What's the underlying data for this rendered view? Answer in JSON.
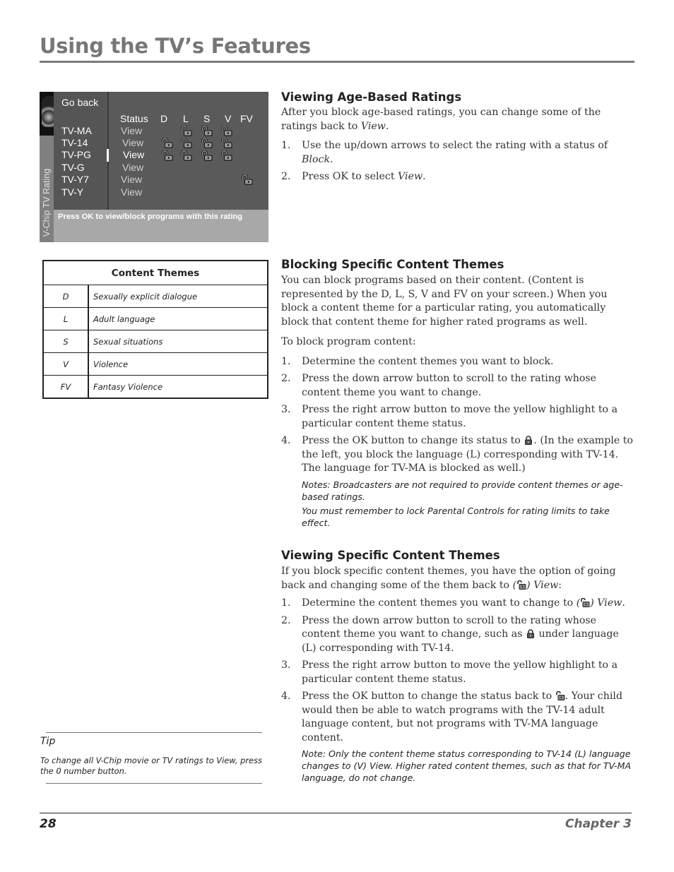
{
  "header": {
    "title": "Using the TV’s Features"
  },
  "tv_screen": {
    "side_label": "V-Chip TV Rating",
    "go_back": "Go back",
    "columns": [
      "Status",
      "D",
      "L",
      "S",
      "V",
      "FV"
    ],
    "ratings": [
      {
        "name": "TV-MA",
        "status": "View",
        "unlocked": [
          "L",
          "S",
          "V"
        ]
      },
      {
        "name": "TV-14",
        "status": "View",
        "unlocked": [
          "D",
          "L",
          "S",
          "V"
        ]
      },
      {
        "name": "TV-PG",
        "status": "View",
        "unlocked": [
          "D",
          "L",
          "S",
          "V"
        ]
      },
      {
        "name": "TV-G",
        "status": "View",
        "unlocked": []
      },
      {
        "name": "TV-Y7",
        "status": "View",
        "unlocked": [
          "FV"
        ]
      },
      {
        "name": "TV-Y",
        "status": "View",
        "unlocked": []
      }
    ],
    "selected_rating": "TV-PG",
    "footer": "Press OK to view/block programs with this rating",
    "icon": "unlocked-padlock-icon"
  },
  "content_themes_table": {
    "title": "Content Themes",
    "rows": [
      {
        "code": "D",
        "meaning": "Sexually explicit dialogue"
      },
      {
        "code": "L",
        "meaning": "Adult language"
      },
      {
        "code": "S",
        "meaning": "Sexual situations"
      },
      {
        "code": "V",
        "meaning": "Violence"
      },
      {
        "code": "FV",
        "meaning": "Fantasy Violence"
      }
    ]
  },
  "sections": {
    "age_based": {
      "heading": "Viewing Age-Based Ratings",
      "intro_a": "After you block age-based ratings, you can change some of the ratings back to ",
      "intro_em": "View",
      "intro_b": ".",
      "steps": [
        {
          "num": "1.",
          "a": "Use the up/down arrows to select the rating with a status of ",
          "em": "Block",
          "b": "."
        },
        {
          "num": "2.",
          "a": "Press OK to select ",
          "em": "View",
          "b": "."
        }
      ]
    },
    "blocking": {
      "heading": "Blocking Specific Content Themes",
      "intro": "You can block programs based on their content. (Content is represented by the D, L, S, V and FV on your screen.) When you block a content theme for a particular rating, you automatically block that content theme for higher rated programs as well.",
      "lead": "To block program content:",
      "steps": [
        {
          "num": "1.",
          "text": "Determine the content themes you want to block."
        },
        {
          "num": "2.",
          "text": "Press the down arrow button to scroll to the rating whose content theme you want to change."
        },
        {
          "num": "3.",
          "text": "Press the right arrow button to move the yellow highlight to a particular content theme status."
        },
        {
          "num": "4.",
          "a": "Press the OK button to change its status to ",
          "b": ". (In the example to the left, you block the language (L) corresponding with TV-14. The language for TV-MA is blocked as well.)"
        }
      ],
      "notes": [
        "Notes: Broadcasters are not required to provide content themes or age-based ratings.",
        "You must remember to lock Parental Controls for rating limits to take effect."
      ]
    },
    "viewing_specific": {
      "heading": "Viewing Specific Content Themes",
      "intro_a": "If you block specific content themes, you have the option of going back and changing some of the them back to ",
      "intro_em": "View",
      "intro_b": ":",
      "steps": [
        {
          "num": "1.",
          "a": "Determine the content themes you want to change to ",
          "em": "View",
          "b": "."
        },
        {
          "num": "2.",
          "a": "Press the down arrow button to scroll to the rating whose content theme you want to change, such as ",
          "b": " under language (L) corresponding with TV-14."
        },
        {
          "num": "3.",
          "text": "Press the right arrow button to move the yellow highlight to a particular content theme status."
        },
        {
          "num": "4.",
          "a": "Press the OK button to change the status back to ",
          "b": ". Your child would then be able to watch programs with the TV-14 adult language content, but not programs with TV-MA language content."
        }
      ],
      "note": "Note:  Only the content theme status corresponding to TV-14  (L) language changes to (V) View. Higher rated content themes, such as that for TV-MA language, do not change."
    }
  },
  "tip": {
    "title": "Tip",
    "text": "To change all V-Chip movie or TV ratings to View, press the 0 number button."
  },
  "footer": {
    "page_number": "28",
    "chapter": "Chapter 3"
  }
}
